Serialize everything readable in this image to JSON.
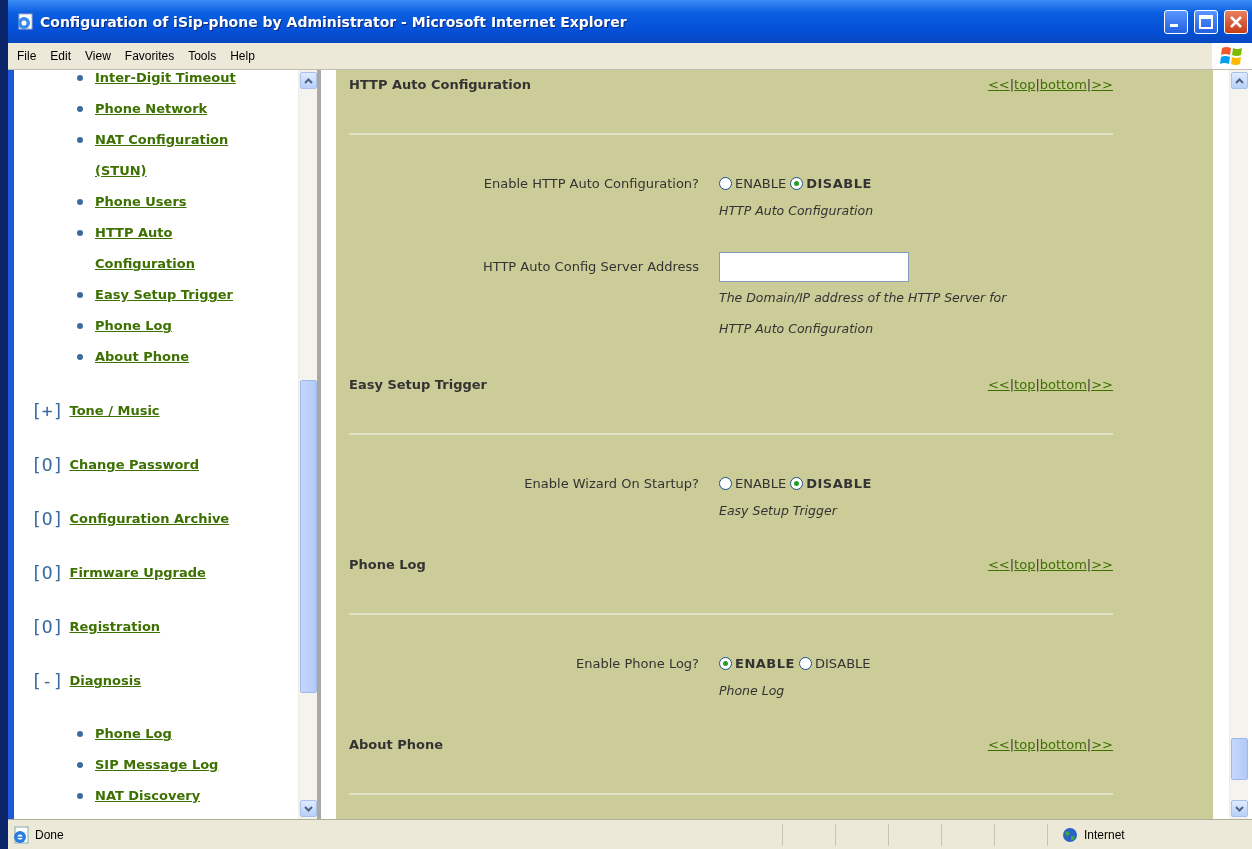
{
  "window": {
    "title": "Configuration of iSip-phone by Administrator - Microsoft Internet Explorer"
  },
  "menu": [
    "File",
    "Edit",
    "View",
    "Favorites",
    "Tools",
    "Help"
  ],
  "sidebar": {
    "items": [
      {
        "label": "Inter-Digit Timeout"
      },
      {
        "label": "Phone Network"
      },
      {
        "label": "NAT Configuration (STUN)"
      },
      {
        "label": "Phone Users"
      },
      {
        "label": "HTTP Auto Configuration"
      },
      {
        "label": "Easy Setup Trigger"
      },
      {
        "label": "Phone Log"
      },
      {
        "label": "About Phone"
      }
    ],
    "groups": [
      {
        "marker": "[+]",
        "label": "Tone / Music"
      },
      {
        "marker": "[O]",
        "label": "Change Password"
      },
      {
        "marker": "[O]",
        "label": "Configuration Archive"
      },
      {
        "marker": "[O]",
        "label": "Firmware Upgrade"
      },
      {
        "marker": "[O]",
        "label": "Registration"
      },
      {
        "marker": "[-]",
        "label": "Diagnosis",
        "children": [
          {
            "label": "Phone Log"
          },
          {
            "label": "SIP Message Log"
          },
          {
            "label": "NAT Discovery"
          }
        ]
      }
    ]
  },
  "nav_separator": "|",
  "sections": [
    {
      "title": "HTTP Auto Configuration",
      "nav": [
        "<<",
        "top",
        "bottom",
        ">>"
      ],
      "fields": [
        {
          "kind": "radio",
          "label": "Enable HTTP Auto Configuration?",
          "options": [
            {
              "label": "ENABLE",
              "selected": false
            },
            {
              "label": "DISABLE",
              "selected": true
            }
          ],
          "help": "HTTP Auto Configuration"
        },
        {
          "kind": "text",
          "label": "HTTP Auto Config Server Address",
          "help": "The Domain/IP address of the HTTP Server for HTTP Auto Configuration"
        }
      ]
    },
    {
      "title": "Easy Setup Trigger",
      "nav": [
        "<<",
        "top",
        "bottom",
        ">>"
      ],
      "fields": [
        {
          "kind": "radio",
          "label": "Enable Wizard On Startup?",
          "options": [
            {
              "label": "ENABLE",
              "selected": false
            },
            {
              "label": "DISABLE",
              "selected": true
            }
          ],
          "help": "Easy Setup Trigger"
        }
      ]
    },
    {
      "title": "Phone Log",
      "nav": [
        "<<",
        "top",
        "bottom",
        ">>"
      ],
      "fields": [
        {
          "kind": "radio",
          "label": "Enable Phone Log?",
          "options": [
            {
              "label": "ENABLE",
              "selected": true
            },
            {
              "label": "DISABLE",
              "selected": false
            }
          ],
          "help": "Phone Log"
        }
      ]
    },
    {
      "title": "About Phone",
      "nav": [
        "<<",
        "top",
        "bottom",
        ">>"
      ]
    }
  ],
  "status_bar": {
    "text": "Done",
    "zone": "Internet"
  }
}
